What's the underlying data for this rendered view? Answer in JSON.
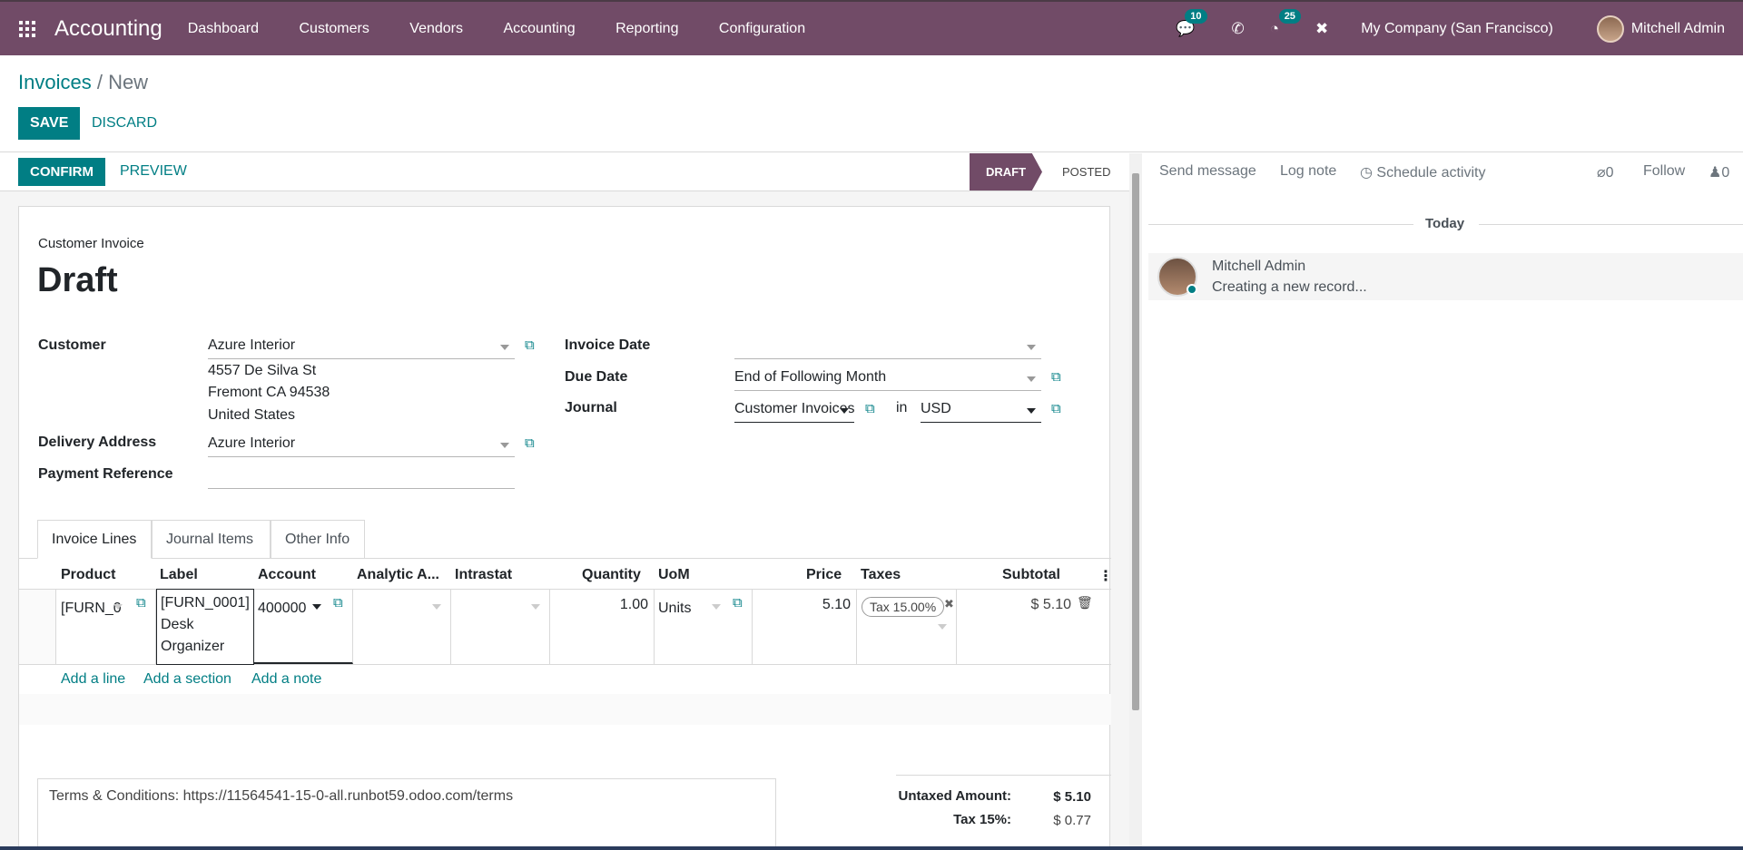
{
  "navbar": {
    "app_name": "Accounting",
    "menu": [
      "Dashboard",
      "Customers",
      "Vendors",
      "Accounting",
      "Reporting",
      "Configuration"
    ],
    "messages_count": "10",
    "activities_count": "25",
    "company": "My Company (San Francisco)",
    "user": "Mitchell Admin"
  },
  "breadcrumb": {
    "parent": "Invoices",
    "separator": " / ",
    "current": "New"
  },
  "buttons": {
    "save": "SAVE",
    "discard": "DISCARD",
    "confirm": "CONFIRM",
    "preview": "PREVIEW"
  },
  "stages": {
    "draft": "DRAFT",
    "posted": "POSTED"
  },
  "invoice": {
    "type_label": "Customer Invoice",
    "name": "Draft",
    "customer_label": "Customer",
    "customer": "Azure Interior",
    "address_1": "4557 De Silva St",
    "address_2": "Fremont CA 94538",
    "address_3": "United States",
    "delivery_label": "Delivery Address",
    "delivery": "Azure Interior",
    "payment_ref_label": "Payment Reference",
    "payment_ref": "",
    "invoice_date_label": "Invoice Date",
    "invoice_date": "",
    "due_date_label": "Due Date",
    "due_date": "End of Following Month",
    "journal_label": "Journal",
    "journal": "Customer Invoices",
    "in_label": "in",
    "currency": "USD"
  },
  "tabs": [
    "Invoice Lines",
    "Journal Items",
    "Other Info"
  ],
  "columns": [
    "Product",
    "Label",
    "Account",
    "Analytic A...",
    "Intrastat",
    "Quantity",
    "UoM",
    "Price",
    "Taxes",
    "Subtotal"
  ],
  "line": {
    "product": "[FURN_0",
    "label_1": "[FURN_0001]",
    "label_2": "Desk",
    "label_3": "Organizer",
    "account": "400000",
    "quantity": "1.00",
    "uom": "Units",
    "price": "5.10",
    "tax": "Tax 15.00%",
    "subtotal": "$ 5.10"
  },
  "add_links": {
    "line": "Add a line",
    "section": "Add a section",
    "note": "Add a note"
  },
  "terms": "Terms & Conditions: https://11564541-15-0-all.runbot59.odoo.com/terms",
  "totals": {
    "untaxed_label": "Untaxed Amount:",
    "untaxed": "$ 5.10",
    "tax_label": "Tax 15%:",
    "tax": "$ 0.77"
  },
  "chatter": {
    "send": "Send message",
    "log": "Log note",
    "schedule": "Schedule activity",
    "attachments": "0",
    "follow": "Follow",
    "followers": "0",
    "today": "Today",
    "author": "Mitchell Admin",
    "body": "Creating a new record..."
  },
  "colors": {
    "brand": "#714b67",
    "accent": "#017e84"
  }
}
